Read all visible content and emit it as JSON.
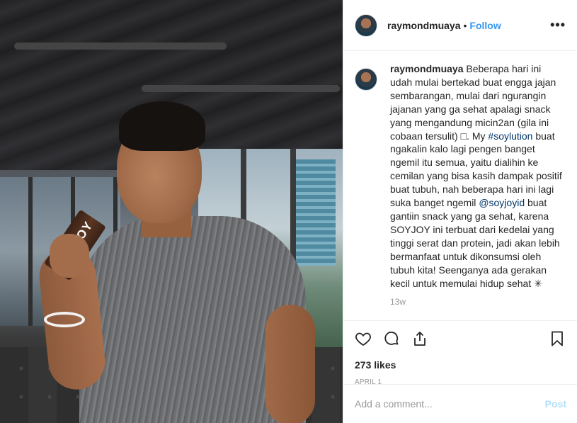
{
  "photo": {
    "product_text": "SOYJOY"
  },
  "header": {
    "username": "raymondmuaya",
    "separator": "•",
    "follow_label": "Follow",
    "more_label": "•••"
  },
  "caption": {
    "username": "raymondmuaya",
    "text_part1": "Beberapa hari ini udah mulai bertekad buat engga jajan sembarangan, mulai dari ngurangin jajanan yang ga sehat apalagi snack yang mengandung micin2an (gila ini cobaan tersulit) □. My ",
    "hashtag": "#soylution",
    "text_part2": " buat ngakalin kalo lagi pengen banget ngemil itu semua, yaitu dialihin ke cemilan yang bisa kasih dampak positif buat tubuh, nah beberapa hari ini lagi suka banget ngemil ",
    "mention": "@soyjoyid",
    "text_part3": " buat gantiin snack yang ga sehat, karena SOYJOY ini terbuat dari kedelai yang tinggi serat dan protein, jadi akan lebih bermanfaat untuk dikonsumsi oleh tubuh kita! Seenganya ada gerakan kecil untuk memulai hidup sehat ✳",
    "time_ago": "13w"
  },
  "icons": {
    "like": "heart-icon",
    "comment": "comment-icon",
    "share": "share-icon",
    "save": "bookmark-icon"
  },
  "likes_text": "273 likes",
  "date_text": "APRIL 1",
  "comment_box": {
    "placeholder": "Add a comment...",
    "post_label": "Post",
    "post_color": "#b2dffc"
  },
  "colors": {
    "link": "#003569",
    "follow": "#3897f0",
    "muted": "#999999"
  }
}
